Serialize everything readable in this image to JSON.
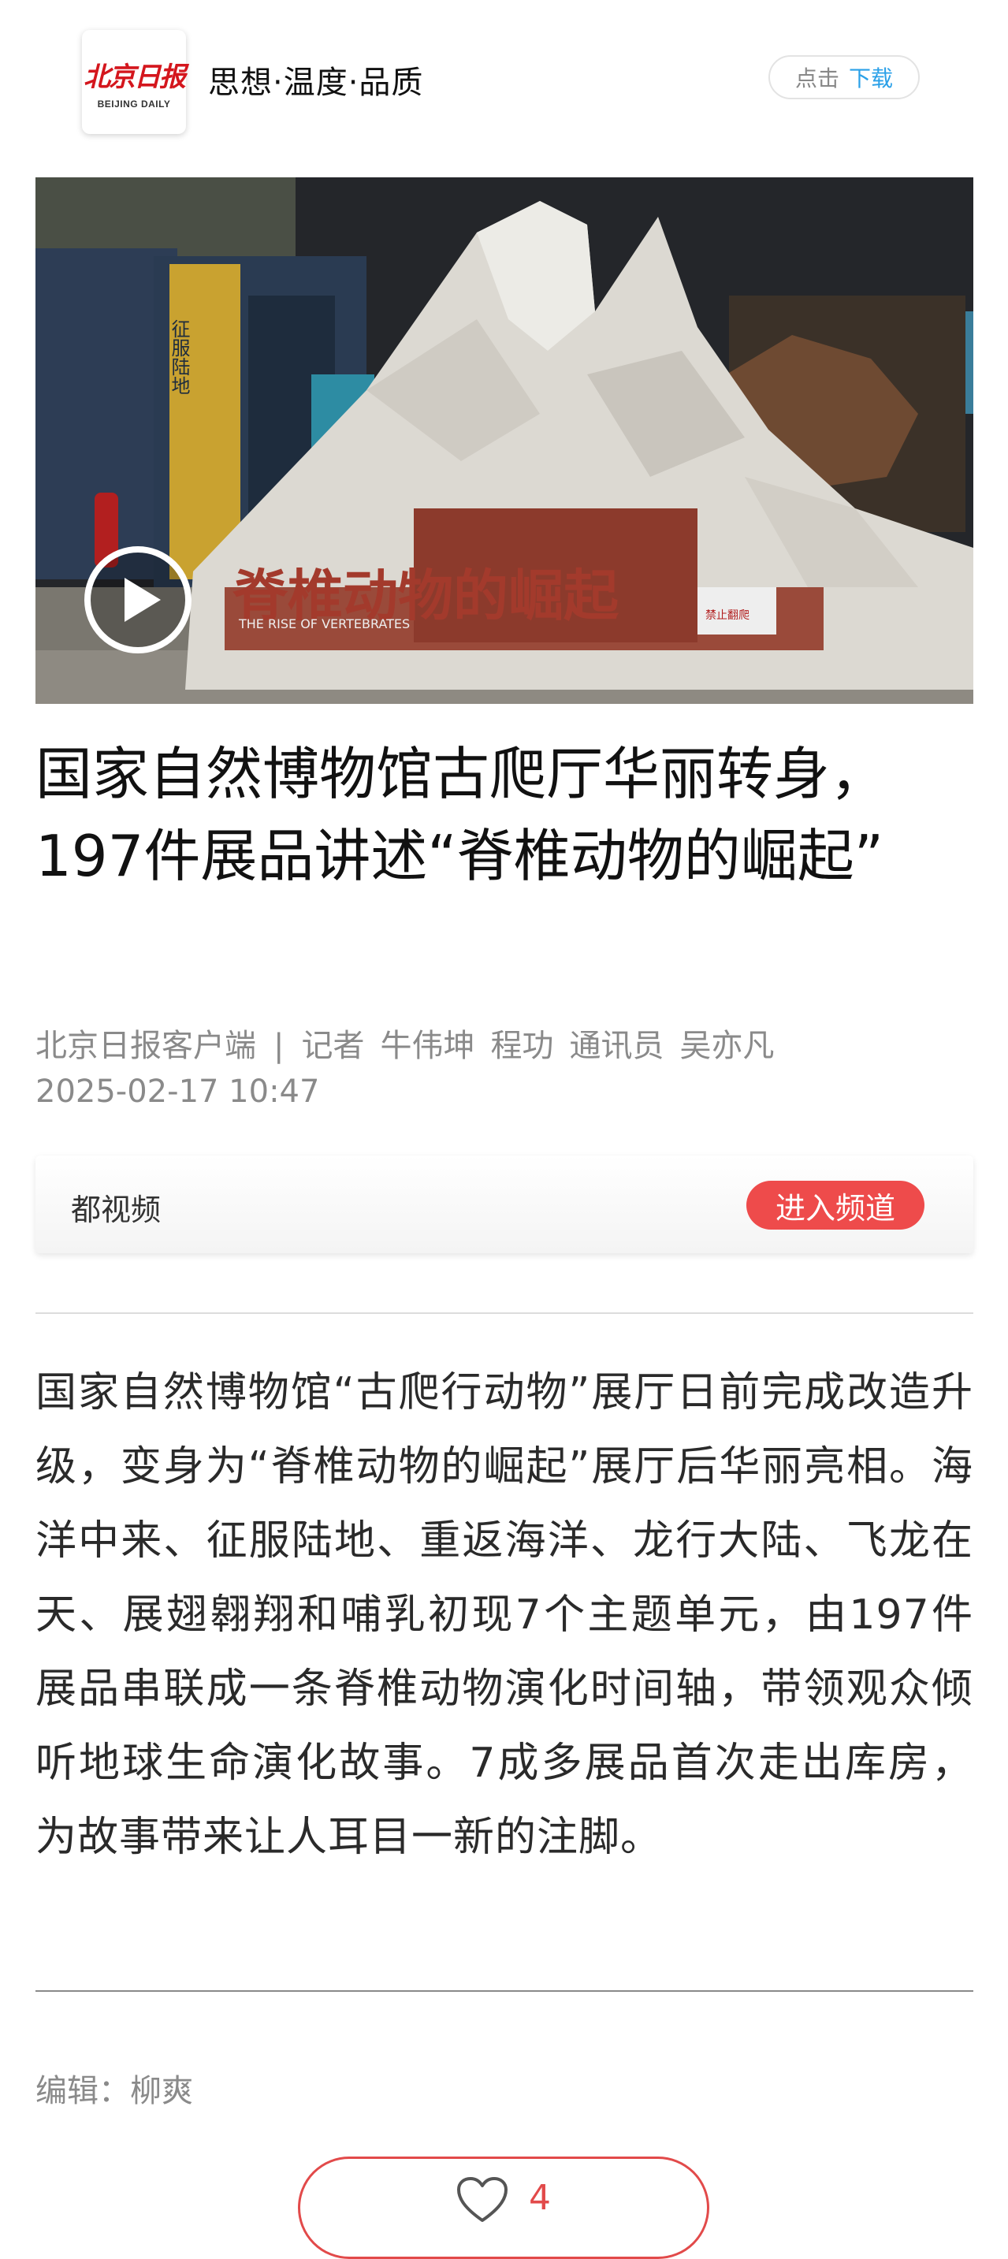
{
  "header": {
    "logo_text": "北京日报",
    "logo_sub": "BEIJING DAILY",
    "slogan": "思想·温度·品质",
    "download_prefix": "点击",
    "download_action": "下载"
  },
  "video": {
    "sign_text": "脊椎动物的崛起",
    "sign_sub": "THE RISE OF VERTEBRATES",
    "side_sign": "征服陆地",
    "notice": "禁止翻爬"
  },
  "article": {
    "title": "国家自然博物馆古爬厅华丽转身，197件展品讲述“脊椎动物的崛起”",
    "source": "北京日报客户端",
    "separator": "|",
    "reporter_label": "记者",
    "reporter_1": "牛伟坤",
    "reporter_2": "程功",
    "correspondent_label": "通讯员",
    "correspondent": "吴亦凡",
    "datetime": "2025-02-17  10:47",
    "body": "国家自然博物馆“古爬行动物”展厅日前完成改造升级，变身为“脊椎动物的崛起”展厅后华丽亮相。海洋中来、征服陆地、重返海洋、龙行大陆、飞龙在天、展翅翱翔和哺乳初现7个主题单元，由197件展品串联成一条脊椎动物演化时间轴，带领观众倾听地球生命演化故事。7成多展品首次走出库房，为故事带来让人耳目一新的注脚。",
    "editor": "编辑：柳爽"
  },
  "channel": {
    "name": "都视频",
    "enter_label": "进入频道"
  },
  "like": {
    "icon": "heart-icon",
    "count": "4"
  },
  "colors": {
    "brand_red": "#d4161d",
    "accent_blue": "#2aa0e8",
    "channel_button": "#ee4b4b",
    "like_red": "#e24a4a"
  }
}
